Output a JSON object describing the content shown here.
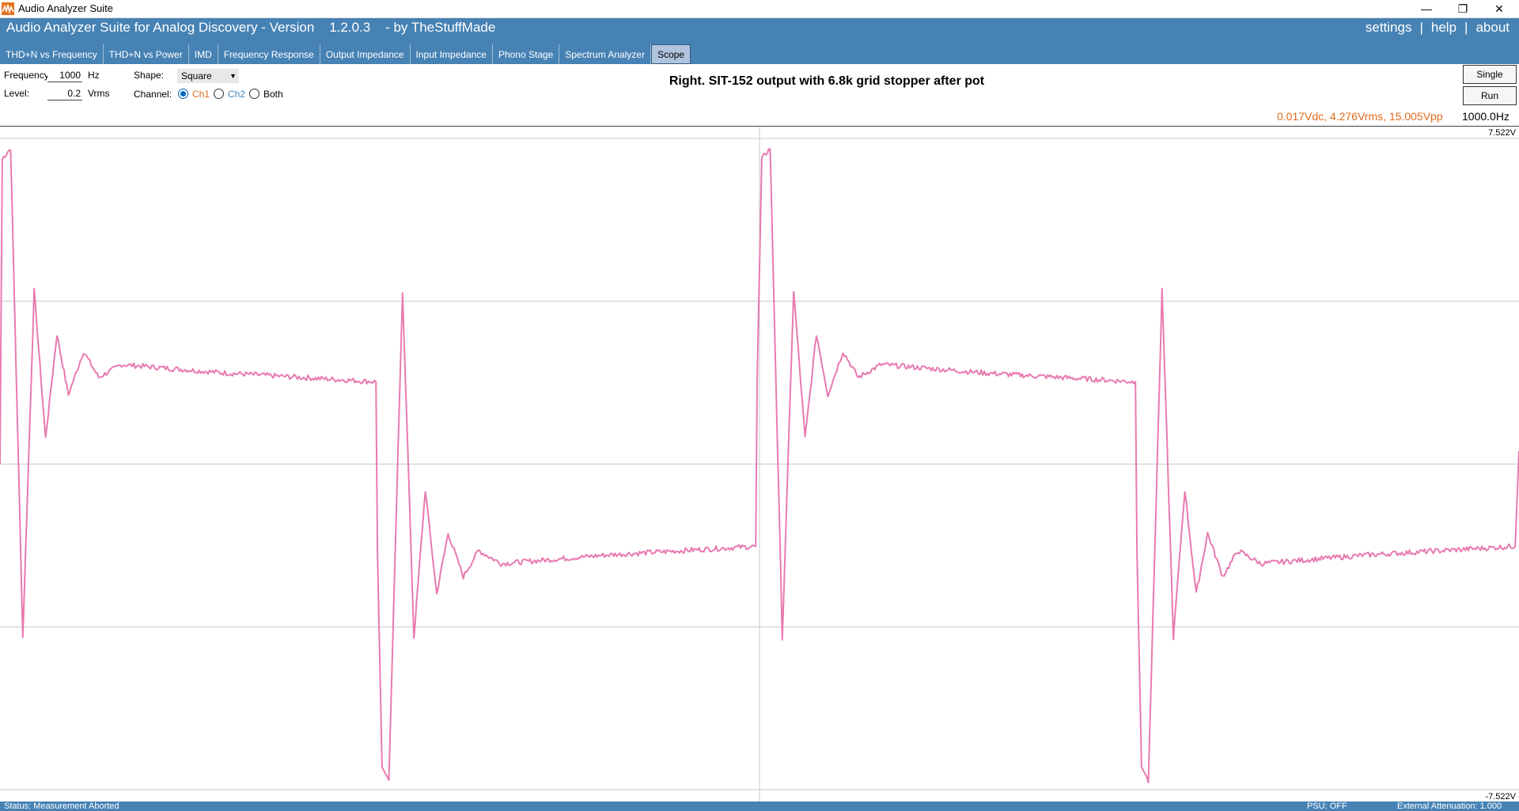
{
  "window": {
    "title": "Audio Analyzer Suite",
    "minimize_glyph": "—",
    "restore_glyph": "❐",
    "close_glyph": "✕"
  },
  "header": {
    "app_title": "Audio Analyzer Suite for Analog Discovery - Version    1.2.0.3    - by TheStuffMade",
    "links": [
      "settings",
      "help",
      "about"
    ],
    "separator": "|"
  },
  "tabs": [
    {
      "label": "THD+N vs Frequency",
      "active": false
    },
    {
      "label": "THD+N vs Power",
      "active": false
    },
    {
      "label": "IMD",
      "active": false
    },
    {
      "label": "Frequency Response",
      "active": false
    },
    {
      "label": "Output Impedance",
      "active": false
    },
    {
      "label": "Input Impedance",
      "active": false
    },
    {
      "label": "Phono Stage",
      "active": false
    },
    {
      "label": "Spectrum Analyzer",
      "active": false
    },
    {
      "label": "Scope",
      "active": true
    }
  ],
  "controls": {
    "frequency_label": "Frequency:",
    "frequency_value": "1000",
    "frequency_unit": "Hz",
    "level_label": "Level:",
    "level_value": "0.2",
    "level_unit": "Vrms",
    "shape_label": "Shape:",
    "shape_value": "Square",
    "channel_label": "Channel:",
    "channels": [
      {
        "label": "Ch1",
        "checked": true,
        "color": "#e06a1c"
      },
      {
        "label": "Ch2",
        "checked": false,
        "color": "#4682b4"
      },
      {
        "label": "Both",
        "checked": false,
        "color": "#000000"
      }
    ],
    "single_label": "Single",
    "run_label": "Run"
  },
  "chart_title": "Right. SIT-152 output with 6.8k grid stopper after pot",
  "measurement": "0.017Vdc, 4.276Vrms, 15.005Vpp",
  "frequency_readout": "1000.0Hz",
  "status": {
    "left": "Status: Measurement Aborted",
    "psu": "PSU: OFF",
    "attenuation": "External Attenuation: 1.000"
  },
  "colors": {
    "header": "#4682b4",
    "trace": "#e87ab0",
    "grid": "#c8c8c8",
    "measurement": "#e06a1c"
  },
  "chart_data": {
    "type": "line",
    "title": "Right. SIT-152 output with 6.8k grid stopper after pot",
    "ylim": [
      -7.522,
      7.522
    ],
    "y_tick_labels": [
      "7.522V",
      "-7.522V"
    ],
    "x_unit": "ms",
    "xlim": [
      0,
      2.0
    ],
    "signal": "square wave with damped ringing at edges",
    "frequency_hz": 1000,
    "series": [
      {
        "name": "Ch1",
        "points": [
          [
            0.0,
            0.0
          ],
          [
            0.003,
            7.05
          ],
          [
            0.014,
            7.3
          ],
          [
            0.03,
            -4.0
          ],
          [
            0.045,
            4.0
          ],
          [
            0.06,
            0.6
          ],
          [
            0.075,
            3.0
          ],
          [
            0.09,
            1.6
          ],
          [
            0.11,
            2.6
          ],
          [
            0.13,
            2.0
          ],
          [
            0.16,
            2.3
          ],
          [
            0.3,
            2.1
          ],
          [
            0.495,
            1.9
          ],
          [
            0.497,
            -2.0
          ],
          [
            0.503,
            -7.0
          ],
          [
            0.512,
            -7.3
          ],
          [
            0.53,
            4.0
          ],
          [
            0.545,
            -4.0
          ],
          [
            0.56,
            -0.6
          ],
          [
            0.575,
            -3.0
          ],
          [
            0.59,
            -1.6
          ],
          [
            0.61,
            -2.6
          ],
          [
            0.63,
            -2.0
          ],
          [
            0.66,
            -2.3
          ],
          [
            0.8,
            -2.1
          ],
          [
            0.995,
            -1.9
          ],
          [
            0.997,
            2.0
          ],
          [
            1.003,
            7.05
          ],
          [
            1.014,
            7.3
          ],
          [
            1.03,
            -4.0
          ],
          [
            1.045,
            4.0
          ],
          [
            1.06,
            0.6
          ],
          [
            1.075,
            3.0
          ],
          [
            1.09,
            1.6
          ],
          [
            1.11,
            2.6
          ],
          [
            1.13,
            2.0
          ],
          [
            1.16,
            2.3
          ],
          [
            1.3,
            2.1
          ],
          [
            1.495,
            1.9
          ],
          [
            1.497,
            -2.0
          ],
          [
            1.503,
            -7.0
          ],
          [
            1.512,
            -7.3
          ],
          [
            1.53,
            4.0
          ],
          [
            1.545,
            -4.0
          ],
          [
            1.56,
            -0.6
          ],
          [
            1.575,
            -3.0
          ],
          [
            1.59,
            -1.6
          ],
          [
            1.61,
            -2.6
          ],
          [
            1.63,
            -2.0
          ],
          [
            1.66,
            -2.3
          ],
          [
            1.8,
            -2.1
          ],
          [
            1.995,
            -1.9
          ],
          [
            2.0,
            0.3
          ]
        ]
      }
    ],
    "grid": true,
    "grid_divisions_x": 2,
    "grid_divisions_y": 4
  }
}
